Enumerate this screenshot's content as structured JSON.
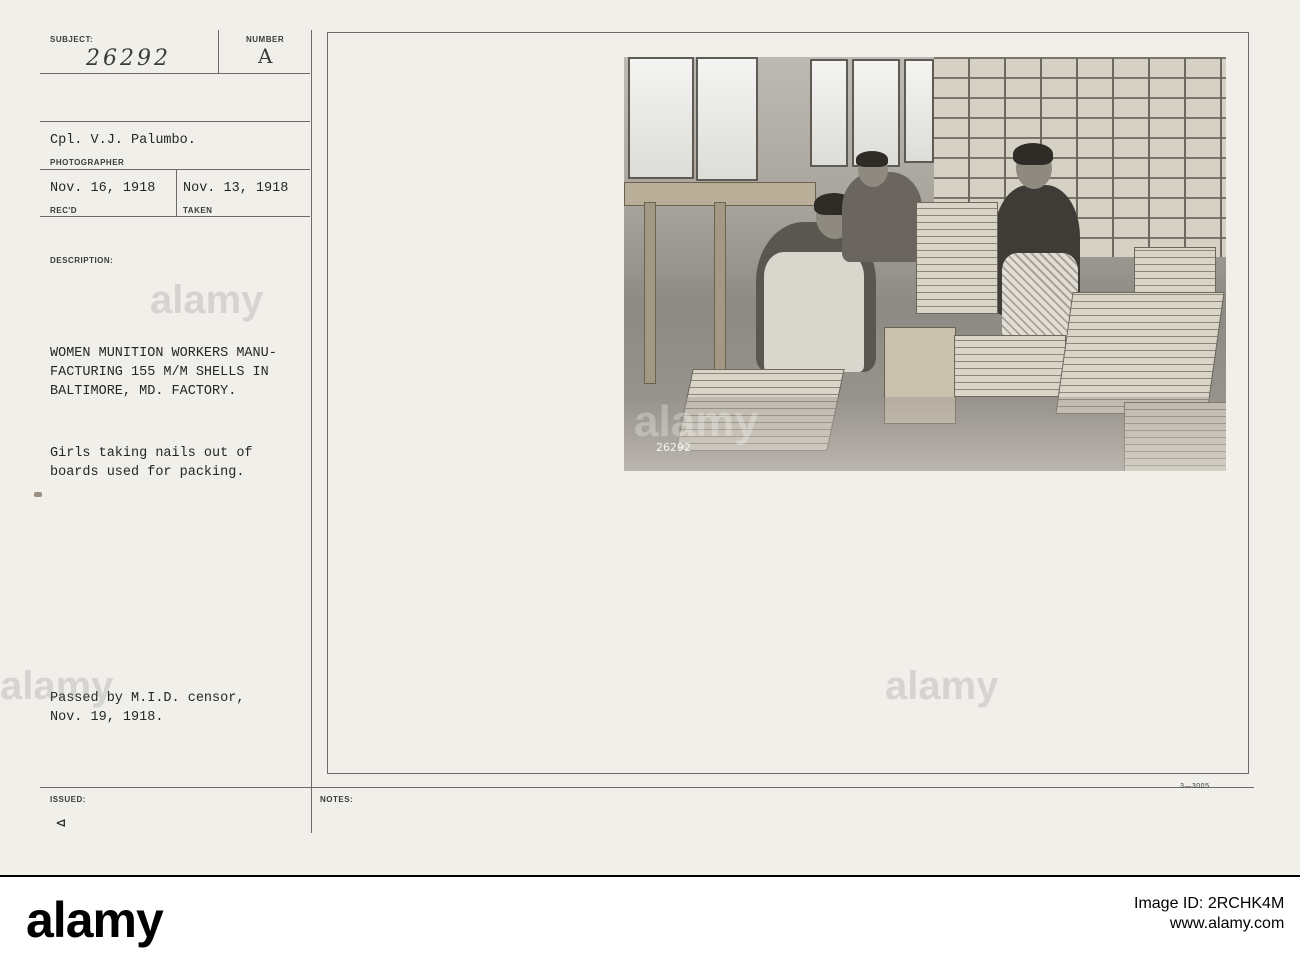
{
  "labels": {
    "subject": "SUBJECT:",
    "number": "NUMBER",
    "photographer": "PHOTOGRAPHER",
    "recd": "REC'D",
    "taken": "TAKEN",
    "description": "DESCRIPTION:",
    "issued": "ISSUED:",
    "notes": "NOTES:"
  },
  "record": {
    "subject_number": "26292",
    "number_value": "A",
    "photographer_name": "Cpl. V.J. Palumbo.",
    "recd_date": "Nov. 16, 1918",
    "taken_date": "Nov. 13, 1918",
    "description_line1": "WOMEN MUNITION WORKERS MANU-",
    "description_line2": "FACTURING 155 M/M SHELLS IN",
    "description_line3": "BALTIMORE, MD. FACTORY.",
    "caption_line1": "Girls taking nails out of",
    "caption_line2": "boards used for packing.",
    "censor_line1": "Passed by M.I.D. censor,",
    "censor_line2": "Nov. 19, 1918.",
    "issued_mark": "⊲",
    "form_code": "3—3005",
    "photo_number": "26292"
  },
  "watermark": "alamy",
  "footer": {
    "brand": "alamy",
    "image_id_label": "Image ID:",
    "image_id": "2RCHK4M",
    "site": "www.alamy.com"
  }
}
